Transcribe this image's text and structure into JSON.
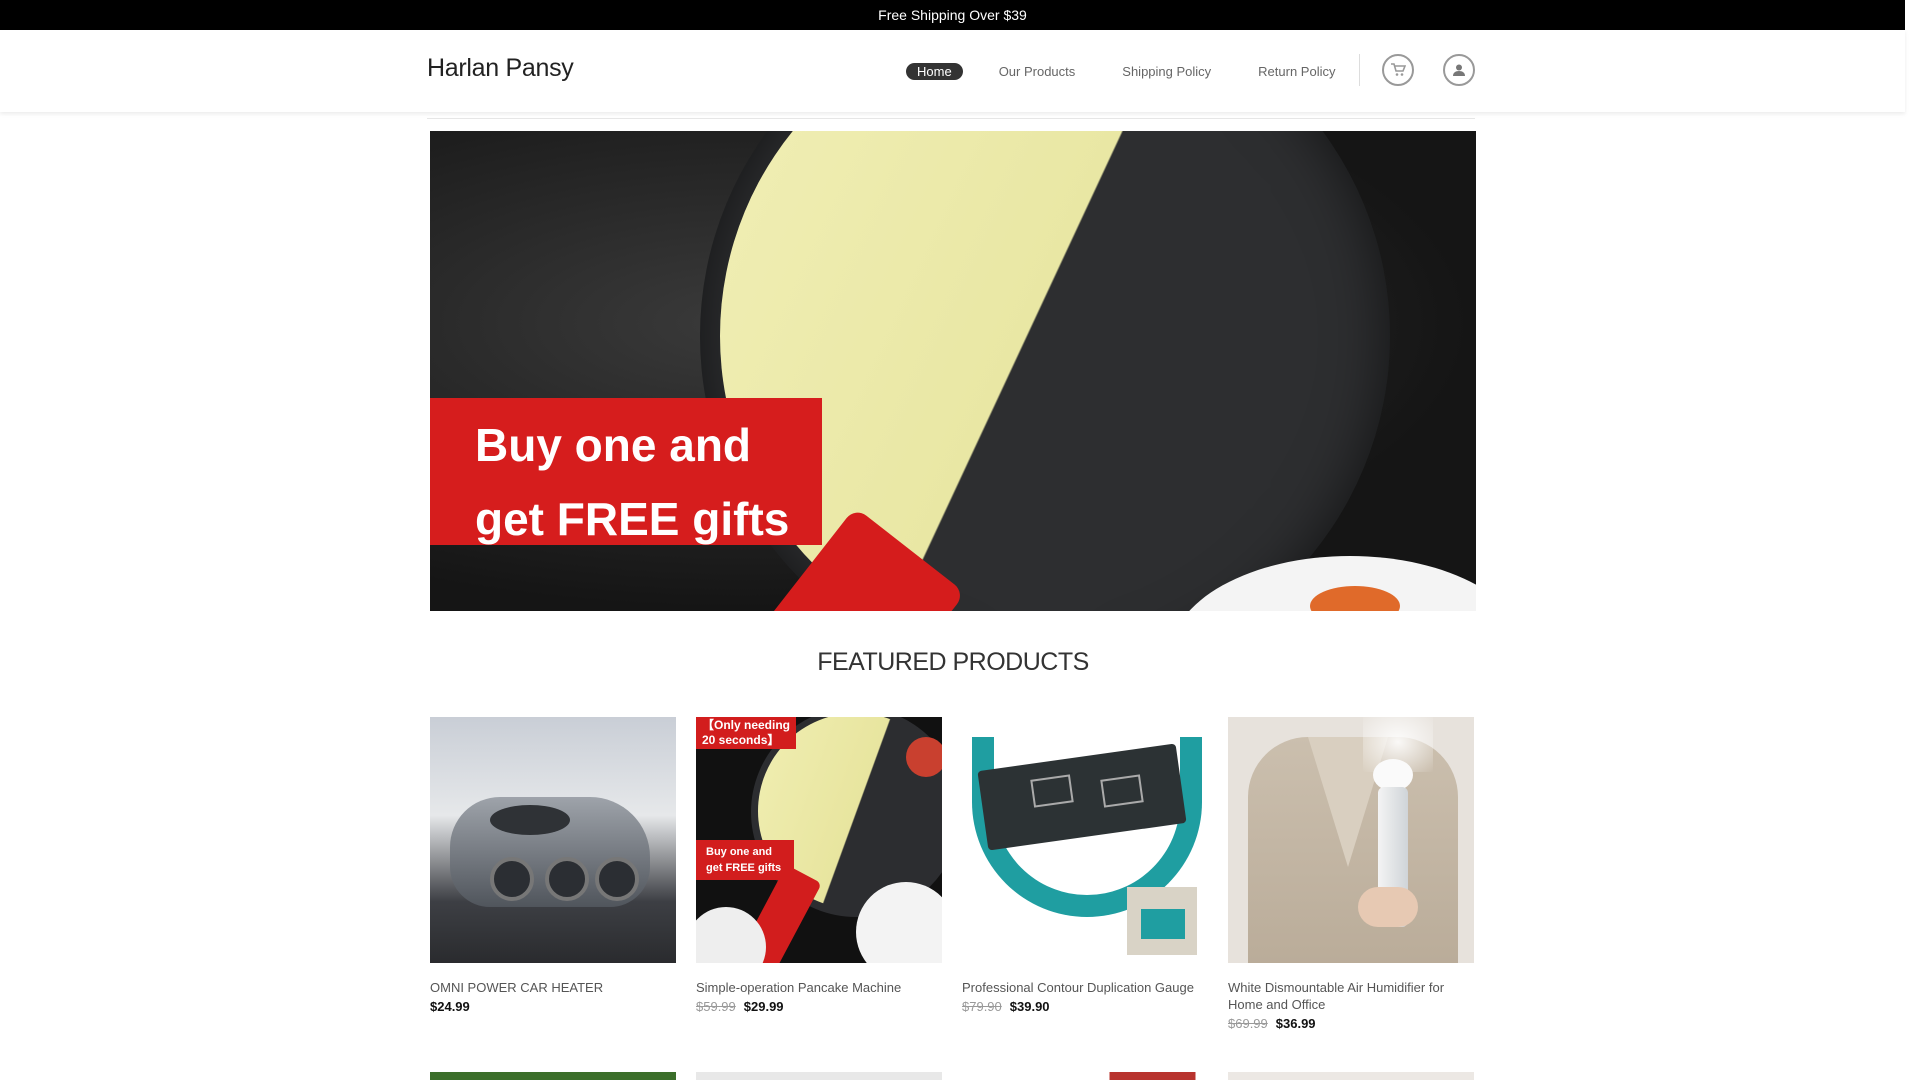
{
  "topbar": {
    "text": "Free Shipping Over $39"
  },
  "header": {
    "logo": "Harlan Pansy",
    "nav": [
      {
        "label": "Home",
        "active": true
      },
      {
        "label": "Our Products"
      },
      {
        "label": "Shipping Policy"
      },
      {
        "label": "Return Policy"
      }
    ],
    "icons": [
      "cart-icon",
      "user-icon"
    ]
  },
  "hero": {
    "line1": "Buy one and",
    "line2": "get  FREE gifts",
    "accent": "#d61d1d"
  },
  "featured": {
    "title": "FEATURED PRODUCTS",
    "products": [
      {
        "name": "OMNI POWER CAR HEATER",
        "old_price": "",
        "price": "$24.99"
      },
      {
        "name": "Simple-operation Pancake Machine",
        "old_price": "$59.99",
        "price": "$29.99",
        "tag_top": "【Only needing 20 seconds】",
        "tag_bottom": "Buy one and get  FREE gifts"
      },
      {
        "name": "Professional Contour Duplication Gauge",
        "old_price": "$79.90",
        "price": "$39.90"
      },
      {
        "name": "White Dismountable Air Humidifier for Home and Office",
        "old_price": "$69.99",
        "price": "$36.99"
      }
    ]
  }
}
